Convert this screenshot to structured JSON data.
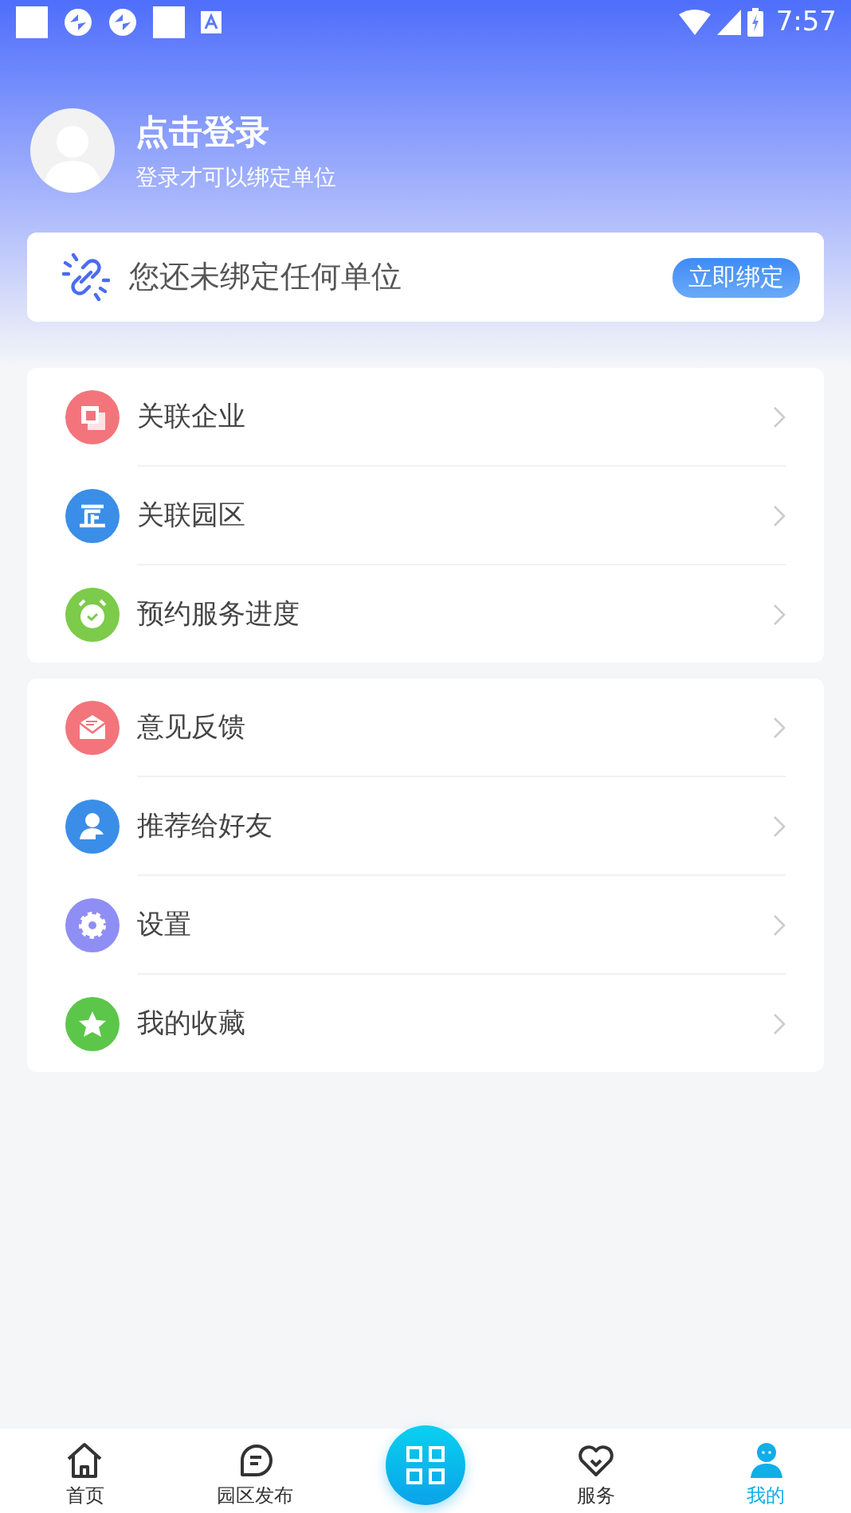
{
  "status_bar": {
    "time": "7:57"
  },
  "profile": {
    "title": "点击登录",
    "subtitle": "登录才可以绑定单位"
  },
  "bind_card": {
    "message": "您还未绑定任何单位",
    "button": "立即绑定"
  },
  "menu_groups": [
    [
      {
        "label": "关联企业",
        "kind": "squares",
        "color": "#f4747c"
      },
      {
        "label": "关联园区",
        "kind": "building",
        "color": "#3a8ee8"
      },
      {
        "label": "预约服务进度",
        "kind": "clock",
        "color": "#7ccb4a"
      }
    ],
    [
      {
        "label": "意见反馈",
        "kind": "mail",
        "color": "#f4747c"
      },
      {
        "label": "推荐给好友",
        "kind": "person",
        "color": "#3a8ee8"
      },
      {
        "label": "设置",
        "kind": "gear",
        "color": "#8f8ef4"
      },
      {
        "label": "我的收藏",
        "kind": "star",
        "color": "#5cc64a"
      }
    ]
  ],
  "bottom_nav": [
    {
      "label": "首页",
      "kind": "home",
      "selected": false
    },
    {
      "label": "园区发布",
      "kind": "chat",
      "selected": false
    },
    {
      "kind": "scan",
      "selected": false
    },
    {
      "label": "服务",
      "kind": "heart",
      "selected": false
    },
    {
      "label": "我的",
      "kind": "user",
      "selected": true
    }
  ]
}
